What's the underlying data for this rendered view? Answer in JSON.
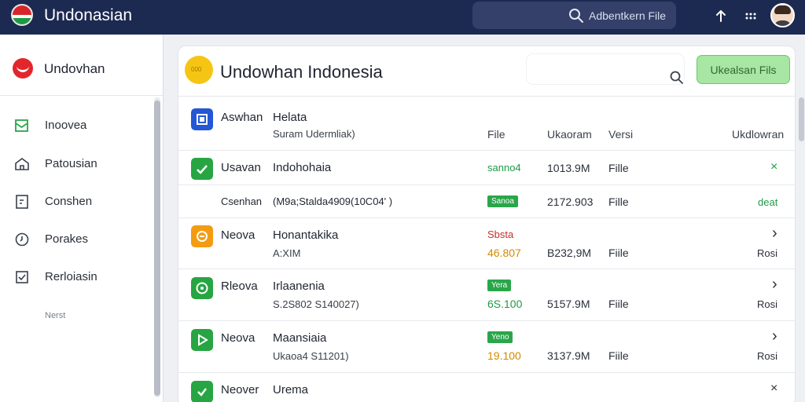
{
  "app": {
    "brand": "Undonasian"
  },
  "search": {
    "placeholder": "Adbentkern File"
  },
  "sidebar": {
    "title": "Undovhan",
    "items": [
      {
        "label": "Inoovea",
        "icon": "inbox-icon"
      },
      {
        "label": "Patousian",
        "icon": "home-icon"
      },
      {
        "label": "Conshen",
        "icon": "note-icon"
      },
      {
        "label": "Porakes",
        "icon": "clock-icon"
      },
      {
        "label": "Rerloiasin",
        "icon": "checkbox-icon"
      }
    ],
    "footer": "Nerst"
  },
  "main": {
    "title": "Undowhan Indonesia",
    "upload_label": "Ukealsan Fils",
    "columns": {
      "name": "Aswhan",
      "desc": "Helata",
      "desc_sub": "Suram Udermliak)",
      "file": "File",
      "size": "Ukaoram",
      "version": "Versi",
      "download": "Ukdlowran"
    },
    "rows": [
      {
        "name": "Usavan",
        "desc": "Indohohaia",
        "status": "sanno4",
        "size": "1013.9M",
        "type": "Fille",
        "action": "×"
      },
      {
        "name": "Csenhan",
        "desc": "(M9a;Stalda4909(10C04'  )",
        "badge": "Sanoa",
        "size": "2172.903",
        "type": "Fille",
        "action": "deat"
      },
      {
        "name": "Neova",
        "desc": "Honantakika",
        "sub": "A:XIM",
        "status": "Sbsta",
        "status2": "46.807",
        "size": "B232,9M",
        "type": "Fiile",
        "action": "›",
        "action2": "Rosi"
      },
      {
        "name": "Rleova",
        "desc": "Irlaanenia",
        "sub": "S.2S802 S140027)",
        "badge": "Yera",
        "status2": "6S.100",
        "size": "5157.9M",
        "type": "Fiile",
        "action": "›",
        "action2": "Rosi"
      },
      {
        "name": "Neova",
        "desc": "Maansiaia",
        "sub": "Ukaoa4 S11201)",
        "badge": "Yeno",
        "status2": "19.100",
        "size": "3137.9M",
        "type": "Fiile",
        "action": "›",
        "action2": "Rosi"
      },
      {
        "name": "Neover",
        "desc": "Urema",
        "action": "×"
      }
    ]
  },
  "colors": {
    "topbar": "#1c2a52",
    "accent_green": "#2aa64a",
    "upload_bg": "#a8e6a3",
    "warning": "#d18b00",
    "danger": "#c4302b"
  }
}
